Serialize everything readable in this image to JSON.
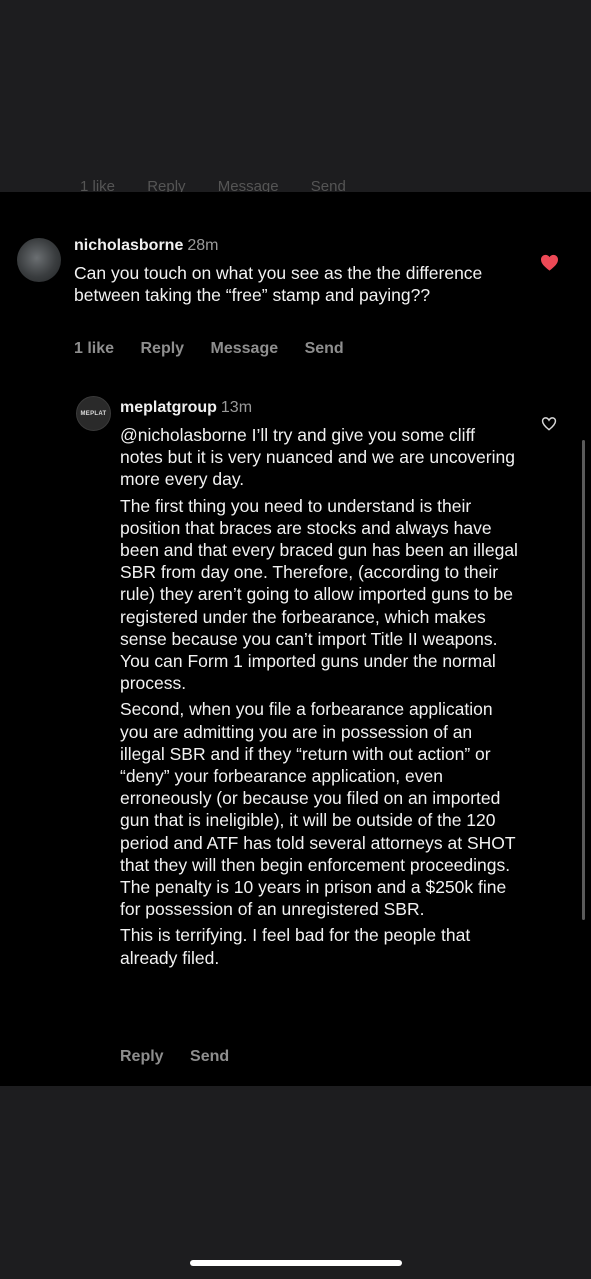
{
  "top_partial_actions": [
    "1 like",
    "Reply",
    "Message",
    "Send"
  ],
  "comment_1": {
    "username": "nicholasborne",
    "time": "28m",
    "text": "Can you touch on what you see as the the difference between taking the “free” stamp and paying??",
    "likes_label": "1 like",
    "reply_label": "Reply",
    "message_label": "Message",
    "send_label": "Send",
    "liked": true,
    "heart_color": "#ed4956"
  },
  "comment_2": {
    "username": "meplatgroup",
    "time": "13m",
    "avatar_logo_text": "MEPLAT",
    "paragraphs": [
      "@nicholasborne I’ll try and give you some cliff notes but it is very nuanced and we are uncovering more every day.",
      "The first thing you need to understand is their position that braces are stocks and always have been and that every braced gun has been an illegal SBR from day one. Therefore, (according to their rule) they aren’t going to allow imported guns to be registered under the forbearance, which makes sense because you can’t import Title II weapons. You can Form 1 imported guns under the normal process.",
      "Second, when you file a forbearance application you are admitting you are in possession of an illegal SBR and if they “return with out action” or “deny” your forbearance application, even erroneously (or because you filed on an imported gun that is ineligible), it will be outside of the 120 period and ATF has told several attorneys at SHOT that they will then begin enforcement proceedings. The penalty is 10 years in prison and a $250k fine for possession of an unregistered SBR.",
      "This is terrifying. I feel bad for the people that already filed."
    ],
    "reply_label": "Reply",
    "send_label": "Send",
    "liked": false
  }
}
